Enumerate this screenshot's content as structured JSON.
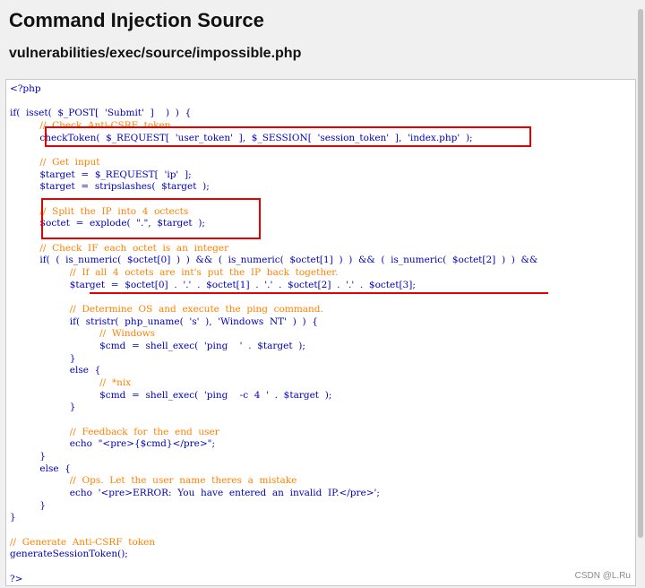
{
  "page": {
    "title": "Command Injection Source",
    "subtitle": "vulnerabilities/exec/source/impossible.php"
  },
  "code": {
    "lines": [
      {
        "text": "<?php"
      },
      {
        "text": ""
      },
      {
        "text": "if(  isset(  $_POST[  'Submit'  ]    )  )  {"
      },
      {
        "text": "          //  Check  Anti-CSRF  token"
      },
      {
        "text": "          checkToken(  $_REQUEST[  'user_token'  ],  $_SESSION[  'session_token'  ],  'index.php'  );"
      },
      {
        "text": ""
      },
      {
        "text": "          //  Get  input"
      },
      {
        "text": "          $target  =  $_REQUEST[  'ip'  ];"
      },
      {
        "text": "          $target  =  stripslashes(  $target  );"
      },
      {
        "text": ""
      },
      {
        "text": "          //  Split  the  IP  into  4  octects"
      },
      {
        "text": "          $octet  =  explode(  \".\",  $target  );"
      },
      {
        "text": ""
      },
      {
        "text": "          //  Check  IF  each  octet  is  an  integer"
      },
      {
        "text": "          if(  (  is_numeric(  $octet[0]  )  )  &&  (  is_numeric(  $octet[1]  )  )  &&  (  is_numeric(  $octet[2]  )  )  &&"
      },
      {
        "text": "                    //  If  all  4  octets  are  int's  put  the  IP  back  together."
      },
      {
        "text": "                    $target  =  $octet[0]  .  '.'  .  $octet[1]  .  '.'  .  $octet[2]  .  '.'  .  $octet[3];"
      },
      {
        "text": ""
      },
      {
        "text": "                    //  Determine  OS  and  execute  the  ping  command."
      },
      {
        "text": "                    if(  stristr(  php_uname(  's'  ),  'Windows  NT'  )  )  {"
      },
      {
        "text": "                              //  Windows"
      },
      {
        "text": "                              $cmd  =  shell_exec(  'ping    '  .  $target  );"
      },
      {
        "text": "                    }"
      },
      {
        "text": "                    else  {"
      },
      {
        "text": "                              //  *nix"
      },
      {
        "text": "                              $cmd  =  shell_exec(  'ping    -c  4  '  .  $target  );"
      },
      {
        "text": "                    }"
      },
      {
        "text": ""
      },
      {
        "text": "                    //  Feedback  for  the  end  user"
      },
      {
        "text": "                    echo  \"<pre>{$cmd}</pre>\";"
      },
      {
        "text": "          }"
      },
      {
        "text": "          else  {"
      },
      {
        "text": "                    //  Ops.  Let  the  user  name  theres  a  mistake"
      },
      {
        "text": "                    echo  '<pre>ERROR:  You  have  entered  an  invalid  IP.</pre>';"
      },
      {
        "text": "          }"
      },
      {
        "text": "}"
      },
      {
        "text": ""
      },
      {
        "text": "//  Generate  Anti-CSRF  token"
      },
      {
        "text": "generateSessionToken();"
      },
      {
        "text": ""
      },
      {
        "text": "?>"
      }
    ]
  },
  "watermark": "CSDN @L.Ru",
  "colors": {
    "keyword_blue": "#0000bb",
    "comment_orange": "#ff8000",
    "string_red": "#dd0000",
    "operator_green": "#007700",
    "annotation_red": "#e60000"
  }
}
